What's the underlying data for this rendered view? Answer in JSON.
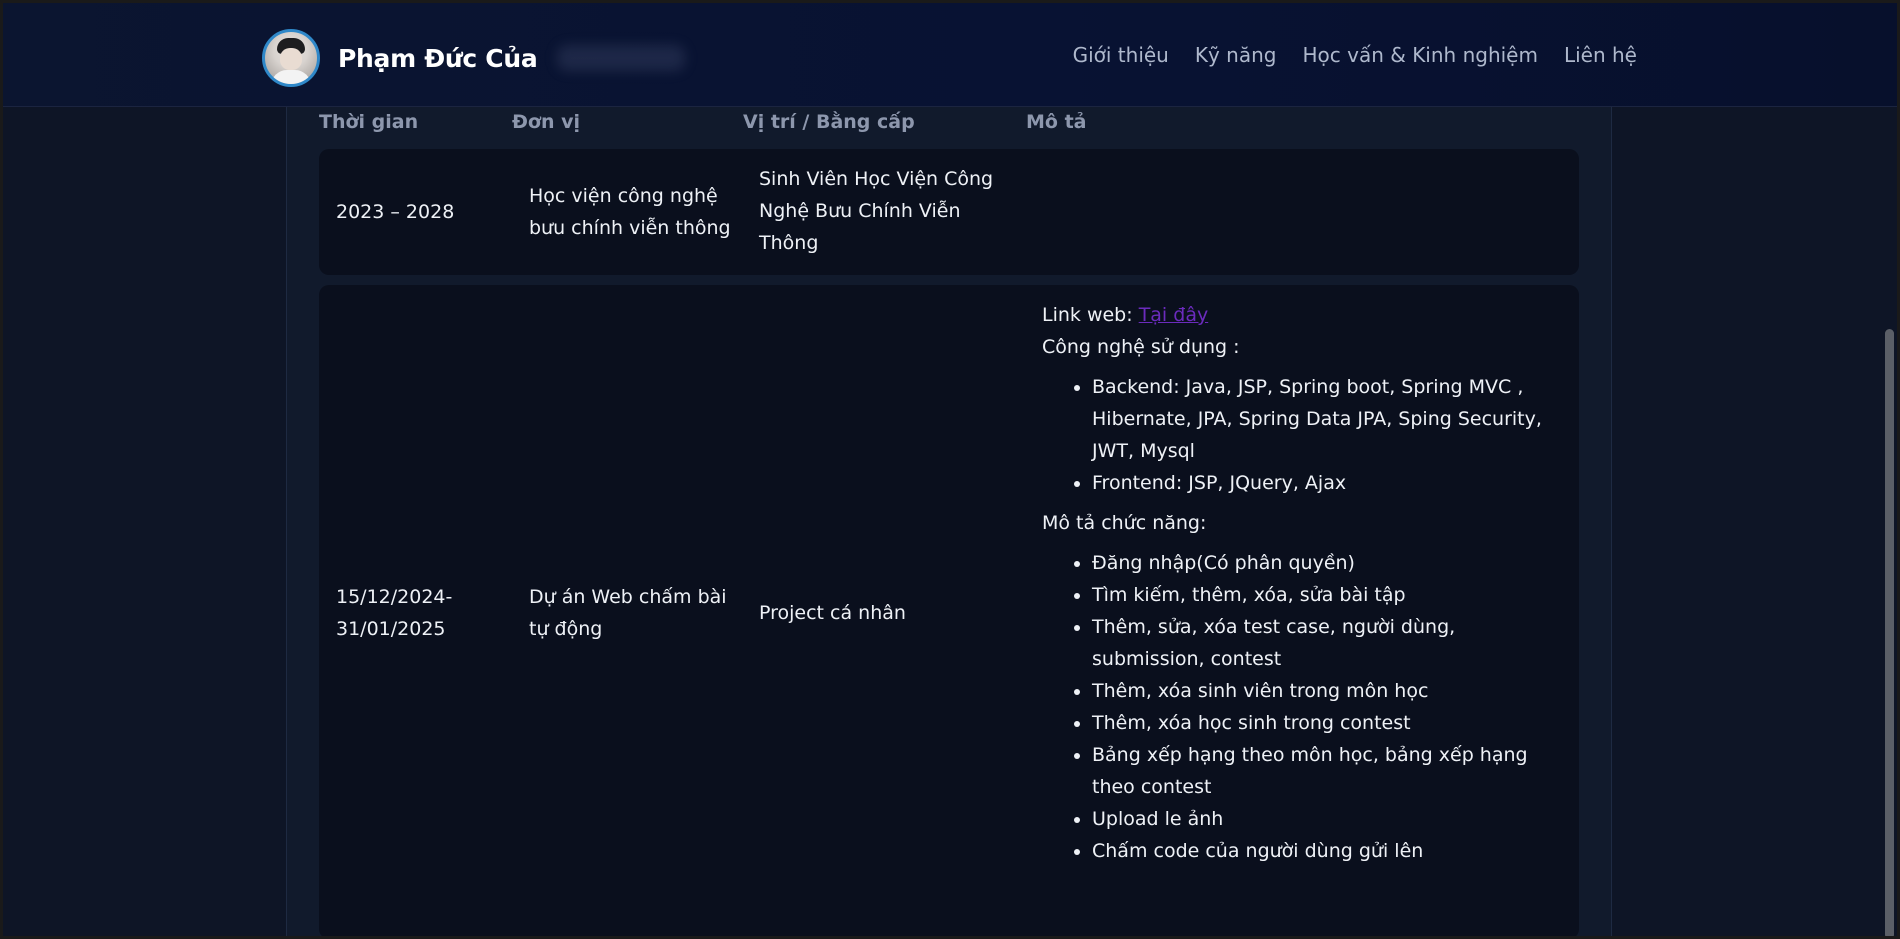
{
  "header": {
    "name": "Phạm Đức Của",
    "nav": [
      "Giới thiệu",
      "Kỹ năng",
      "Học vấn & Kinh nghiệm",
      "Liên hệ"
    ]
  },
  "table": {
    "headers": [
      "Thời gian",
      "Đơn vị",
      "Vị trí / Bằng cấp",
      "Mô tả"
    ],
    "rows": [
      {
        "time": "2023 – 2028",
        "unit_lines": [
          "Học viện công nghệ",
          "bưu chính viễn thông"
        ],
        "position_lines": [
          "Sinh Viên Học Viện Công",
          "Nghệ Bưu Chính Viễn",
          "Thông"
        ]
      },
      {
        "time_lines": [
          "15/12/2024-",
          "31/01/2025"
        ],
        "unit_lines": [
          "Dự án Web chấm bài",
          "tự động"
        ],
        "position": "Project cá nhân",
        "desc": {
          "link_prefix": "Link web: ",
          "link_text": "Tại đây",
          "tech_title": "Công nghệ sử dụng :",
          "tech_items": [
            "Backend: Java, JSP, Spring boot, Spring MVC , Hibernate, JPA, Spring Data JPA, Sping Security, JWT, Mysql",
            "Frontend: JSP, JQuery, Ajax"
          ],
          "func_title": "Mô tả chức năng:",
          "func_items": [
            "Đăng nhập(Có phân quyền)",
            "Tìm kiếm, thêm, xóa, sửa bài tập",
            "Thêm, sửa, xóa test case, người dùng, submission, contest",
            "Thêm, xóa sinh viên trong môn học",
            "Thêm, xóa học sinh trong contest",
            "Bảng xếp hạng theo môn học, bảng xếp hạng theo contest",
            "Upload le ảnh",
            "Chấm code của người dùng gửi lên"
          ]
        }
      }
    ]
  }
}
